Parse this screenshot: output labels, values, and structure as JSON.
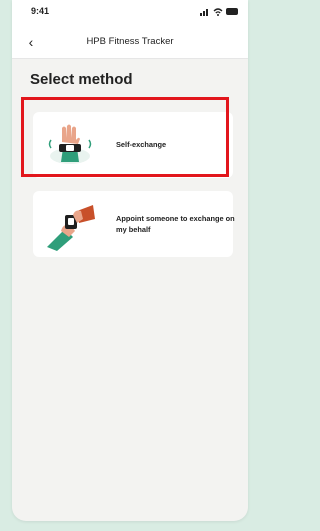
{
  "status_bar": {
    "time": "9:41"
  },
  "nav": {
    "title": "HPB Fitness Tracker",
    "back_icon": "chevron-left-icon"
  },
  "page": {
    "title": "Select method"
  },
  "options": [
    {
      "label": "Self-exchange",
      "illustration": "hand-with-tracker-illustration",
      "highlighted": true
    },
    {
      "label": "Appoint someone to exchange on my behalf",
      "illustration": "handover-tracker-illustration",
      "highlighted": false
    }
  ],
  "colors": {
    "highlight": "#e2161c",
    "accent_green": "#2f9e7a",
    "accent_orange": "#c8502a"
  }
}
